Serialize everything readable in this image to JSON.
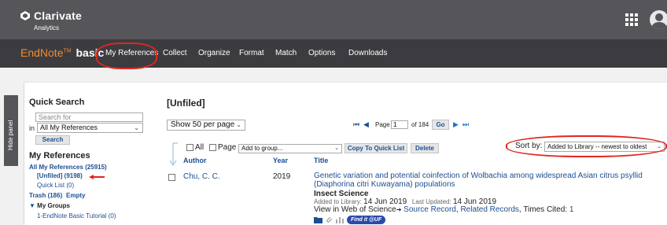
{
  "header": {
    "logo_name": "Clarivate",
    "logo_sub": "Analytics",
    "apps_icon": "grid-apps-icon",
    "avatar_icon": "user-avatar-icon"
  },
  "nav": {
    "brand_main": "EndNote",
    "brand_tm": "TM",
    "brand_suffix": "basic",
    "items": [
      "My References",
      "Collect",
      "Organize",
      "Format",
      "Match",
      "Options",
      "Downloads"
    ]
  },
  "sidebar": {
    "hide_panel": "Hide panel",
    "quick_search_title": "Quick Search",
    "search_placeholder": "Search for",
    "in_label": "in",
    "scope_value": "All My References",
    "search_button": "Search",
    "my_refs_title": "My References",
    "all_refs": "All My References (25915)",
    "unfiled": "[Unfiled] (9198)",
    "quick_list": "Quick List (0)",
    "trash": "Trash (186)",
    "empty": "Empty",
    "my_groups": "My Groups",
    "group_1": "1-EndNote Basic Tutorial (0)"
  },
  "main": {
    "title": "[Unfiled]",
    "show_per_page": "Show 50 per page",
    "page_label": "Page",
    "page_value": "1",
    "of_pages": "of 184",
    "go": "Go",
    "all_label": "All",
    "page_cb_label": "Page",
    "add_to_group": "Add to group...",
    "copy_quick_list": "Copy To Quick List",
    "delete": "Delete",
    "sort_by": "Sort by:",
    "sort_value": "Added to Library -- newest to oldest",
    "columns": [
      "Author",
      "Year",
      "Title"
    ]
  },
  "record": {
    "author": "Chu, C. C.",
    "year": "2019",
    "title": "Genetic variation and potential coinfection of Wolbachia among widespread Asian citrus psyllid (Diaphorina citri Kuwayama) populations",
    "journal": "Insect Science",
    "added_label": "Added to Library:",
    "added_value": "14 Jun 2019",
    "updated_label": "Last Updated:",
    "updated_value": "14 Jun 2019",
    "wos_prefix": "View in Web of Science",
    "source_record": "Source Record",
    "related_records": "Related Records",
    "times_cited_label": "Times Cited:",
    "times_cited_value": "1",
    "findit": "Find it @UF"
  },
  "colors": {
    "topbar": "#55555a",
    "navbar": "#3c3c40",
    "brand_orange": "#f28a2e",
    "link_blue": "#1d4f91",
    "annotation_red": "#e0261f"
  }
}
